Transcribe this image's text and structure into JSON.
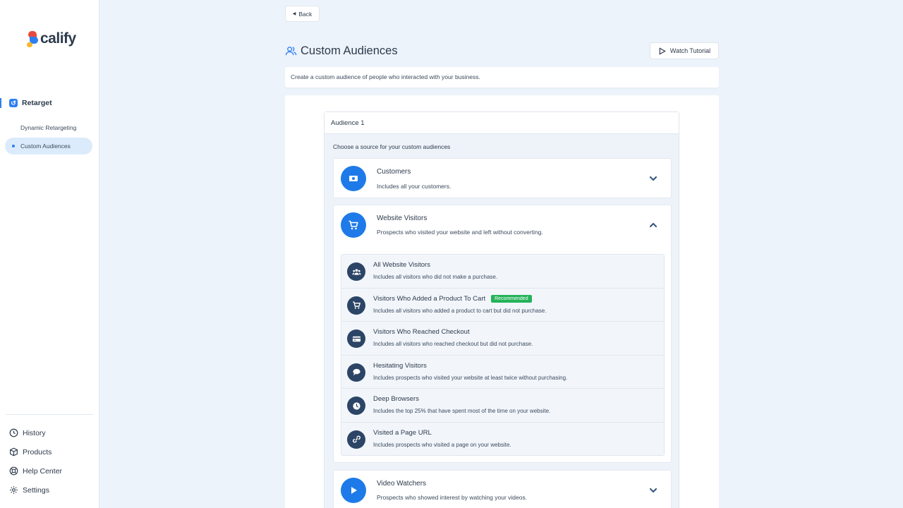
{
  "brand": {
    "logo_text": "calify"
  },
  "sidebar": {
    "parent_label": "Retarget",
    "sub_items": [
      {
        "label": "Dynamic Retargeting"
      },
      {
        "label": "Custom Audiences"
      }
    ],
    "bottom_items": [
      {
        "label": "History",
        "icon": "clock-icon"
      },
      {
        "label": "Products",
        "icon": "box-icon"
      },
      {
        "label": "Help Center",
        "icon": "lifebuoy-icon"
      },
      {
        "label": "Settings",
        "icon": "gear-icon"
      }
    ]
  },
  "header": {
    "back_label": "Back",
    "title": "Custom Audiences",
    "tutorial_label": "Watch Tutorial",
    "description": "Create a custom audience of people who interacted with your business."
  },
  "audience": {
    "title": "Audience 1",
    "choose_label": "Choose a source for your custom audiences",
    "sources": [
      {
        "title": "Customers",
        "subtitle": "Includes all your customers.",
        "icon": "money-icon",
        "expanded": false
      },
      {
        "title": "Website Visitors",
        "subtitle": "Prospects who visited your website and left without converting.",
        "icon": "cart-icon",
        "expanded": true
      },
      {
        "title": "Video Watchers",
        "subtitle": "Prospects who showed interest by watching your videos.",
        "icon": "play-icon",
        "expanded": false
      }
    ],
    "visitor_options": [
      {
        "title": "All Website Visitors",
        "subtitle": "Includes all visitors who did not make a purchase.",
        "icon": "users-icon"
      },
      {
        "title": "Visitors Who Added a Product To Cart",
        "subtitle": "Includes all visitors who added a product to cart but did not purchase.",
        "icon": "cart-icon",
        "badge": "Recommended"
      },
      {
        "title": "Visitors Who Reached Checkout",
        "subtitle": "Includes all visitors who reached checkout but did not purchase.",
        "icon": "credit-card-icon"
      },
      {
        "title": "Hesitating Visitors",
        "subtitle": "Includes prospects who visited your website at least twice without purchasing.",
        "icon": "chat-icon"
      },
      {
        "title": "Deep Browsers",
        "subtitle": "Includes the top 25% that have spent most of the time on your website.",
        "icon": "clock-icon"
      },
      {
        "title": "Visited a Page URL",
        "subtitle": "Includes prospects who visited a page on your website.",
        "icon": "link-icon"
      }
    ]
  },
  "colors": {
    "accent": "#1e7ae8",
    "badge": "#25b35a",
    "icon_dark": "#2c4566",
    "background": "#edf3fb"
  }
}
